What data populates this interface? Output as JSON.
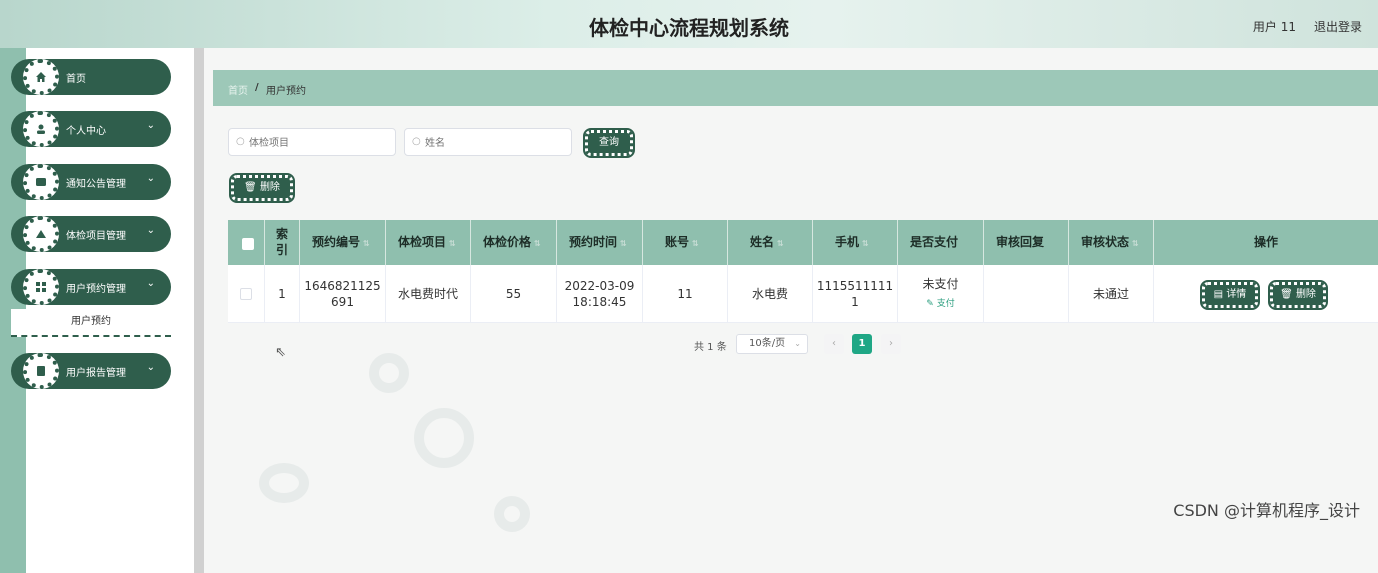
{
  "header": {
    "title": "体检中心流程规划系统",
    "user": "用户 11",
    "logout": "退出登录"
  },
  "sidebar": {
    "items": [
      {
        "label": "首页",
        "icon": "home-icon",
        "expandable": false
      },
      {
        "label": "个人中心",
        "icon": "user-icon",
        "expandable": true
      },
      {
        "label": "通知公告管理",
        "icon": "notice-icon",
        "expandable": true
      },
      {
        "label": "体检项目管理",
        "icon": "project-icon",
        "expandable": true
      },
      {
        "label": "用户预约管理",
        "icon": "grid-icon",
        "expandable": true
      },
      {
        "label": "用户报告管理",
        "icon": "report-icon",
        "expandable": true
      }
    ],
    "sub_item": "用户预约",
    "chevron": "⌄"
  },
  "breadcrumb": {
    "home": "首页",
    "separator": "/",
    "current": "用户预约"
  },
  "search": {
    "project_placeholder": "体检项目",
    "name_placeholder": "姓名",
    "query_button": "查询",
    "delete_button": "删除"
  },
  "table": {
    "columns": [
      "索引",
      "预约编号",
      "体检项目",
      "体检价格",
      "预约时间",
      "账号",
      "姓名",
      "手机",
      "是否支付",
      "审核回复",
      "审核状态",
      "操作"
    ],
    "index_col_line1": "索",
    "index_col_line2": "引",
    "rows": [
      {
        "index": "1",
        "booking_no_line1": "1646821125",
        "booking_no_line2": "691",
        "project": "水电费时代",
        "price": "55",
        "time_line1": "2022-03-09",
        "time_line2": "18:18:45",
        "account": "11",
        "name": "水电费",
        "phone_line1": "1115511111",
        "phone_line2": "1",
        "paid": "未支付",
        "pay_link": "支付",
        "review_reply": "",
        "review_status": "未通过",
        "detail_button": "详情",
        "delete_button": "删除"
      }
    ]
  },
  "pagination": {
    "total": "共 1 条",
    "page_size": "10条/页",
    "prev": "‹",
    "current_page": "1",
    "next": "›"
  },
  "watermark": "CSDN @计算机程序_设计",
  "colors": {
    "accent_dark": "#2f5e4c",
    "accent_light": "#8fbfae",
    "active_page": "#1fa785"
  }
}
